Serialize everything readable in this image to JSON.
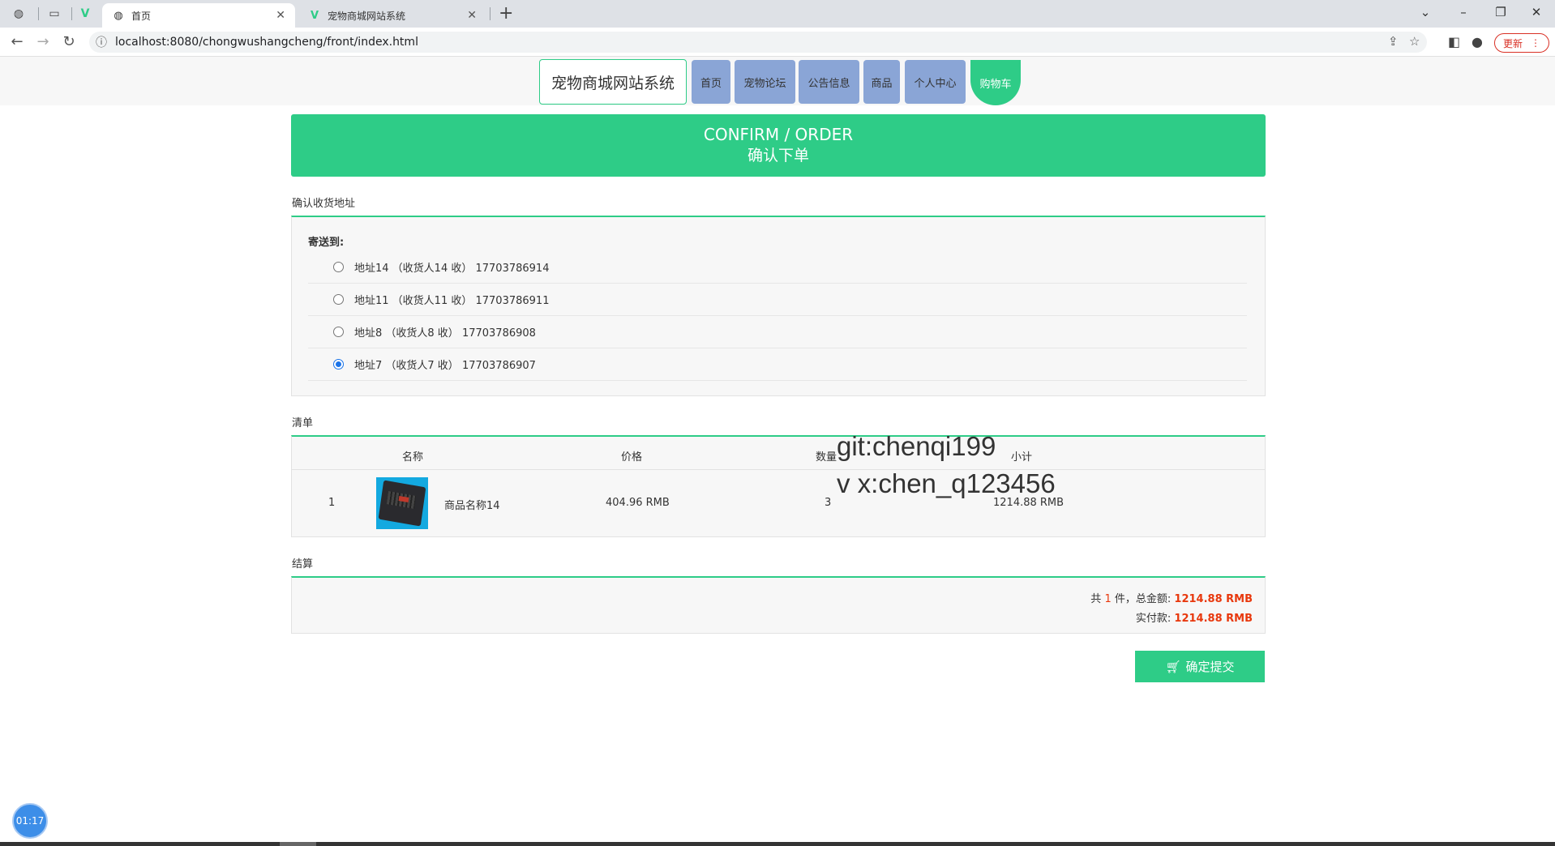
{
  "browser": {
    "tabs": [
      {
        "title": "首页",
        "icon": "globe-icon",
        "active": true
      },
      {
        "title": "宠物商城网站系统",
        "icon": "vue-icon",
        "active": false
      }
    ],
    "url": "localhost:8080/chongwushangcheng/front/index.html",
    "update_label": "更新"
  },
  "site": {
    "title": "宠物商城网站系统",
    "nav": [
      "首页",
      "宠物论坛",
      "公告信息",
      "商品",
      "个人中心",
      "购物车"
    ],
    "active_nav": "购物车"
  },
  "banner": {
    "en": "CONFIRM / ORDER",
    "cn": "确认下单"
  },
  "address_section": {
    "title": "确认收货地址",
    "ship_to_label": "寄送到:",
    "addresses": [
      {
        "text": "地址14 （收货人14 收） 17703786914",
        "selected": false
      },
      {
        "text": "地址11 （收货人11 收） 17703786911",
        "selected": false
      },
      {
        "text": "地址8 （收货人8 收） 17703786908",
        "selected": false
      },
      {
        "text": "地址7 （收货人7 收） 17703786907",
        "selected": true
      }
    ]
  },
  "list_section": {
    "title": "清单",
    "headers": {
      "name": "名称",
      "price": "价格",
      "qty": "数量",
      "subtotal": "小计"
    },
    "rows": [
      {
        "index": "1",
        "name": "商品名称14",
        "price": "404.96 RMB",
        "qty": "3",
        "subtotal": "1214.88 RMB"
      }
    ]
  },
  "settle_section": {
    "title": "结算",
    "count_prefix": "共",
    "count": "1",
    "count_suffix": "件，总金额:",
    "total": "1214.88 RMB",
    "paid_label": "实付款:",
    "paid": "1214.88 RMB"
  },
  "submit_label": "确定提交",
  "watermark": {
    "line1": "git:chenqi199",
    "line2": "v x:chen_q123456"
  },
  "timer": "01:17",
  "colors": {
    "accent": "#2ecc87",
    "nav": "#8aa5d6",
    "price_red": "#e8380d"
  }
}
